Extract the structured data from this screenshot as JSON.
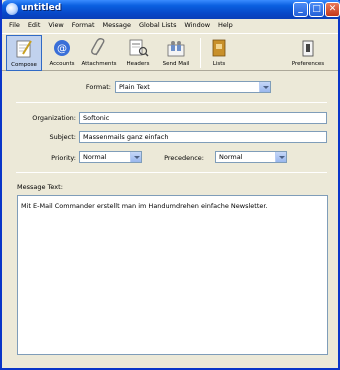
{
  "window": {
    "title": "untitled",
    "controls": {
      "minimize": "_",
      "maximize": "□",
      "close": "✕"
    }
  },
  "menu": [
    "File",
    "Edit",
    "View",
    "Format",
    "Message",
    "Global Lists",
    "Window",
    "Help"
  ],
  "toolbar": {
    "compose": "Compose",
    "accounts": "Accounts",
    "attachments": "Attachments",
    "headers": "Headers",
    "send_mail": "Send Mail",
    "lists": "Lists",
    "preferences": "Preferences"
  },
  "format": {
    "label": "Format:",
    "value": "Plain Text"
  },
  "organization": {
    "label": "Organization:",
    "value": "Softonic"
  },
  "subject": {
    "label": "Subject:",
    "value": "Massenmails ganz einfach"
  },
  "priority": {
    "label": "Priority:",
    "value": "Normal"
  },
  "precedence": {
    "label": "Precedence:",
    "value": "Normal"
  },
  "message": {
    "label": "Message Text:",
    "body": "Mit E-Mail Commander erstellt man im Handumdrehen einfache Newsletter."
  }
}
